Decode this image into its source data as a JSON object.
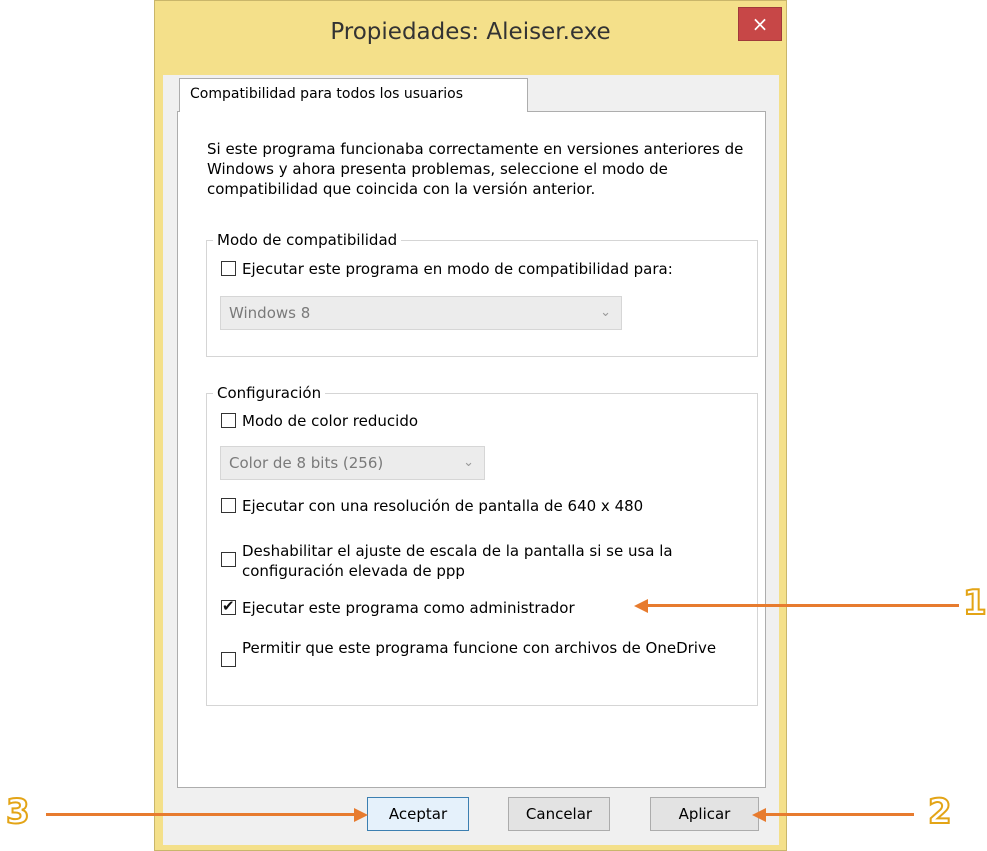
{
  "window": {
    "title": "Propiedades: Aleiser.exe",
    "close_label": "×"
  },
  "tab": {
    "label": "Compatibilidad para todos los usuarios"
  },
  "description": "Si este programa funcionaba correctamente en versiones anteriores de Windows y ahora presenta problemas, seleccione el modo de compatibilidad que coincida con la versión anterior.",
  "compat_group": {
    "legend": "Modo de compatibilidad",
    "checkbox_label": "Ejecutar este programa en modo de compatibilidad para:",
    "checked": false,
    "select_value": "Windows 8"
  },
  "settings_group": {
    "legend": "Configuración",
    "reduced_color": {
      "label": "Modo de color reducido",
      "checked": false
    },
    "color_select_value": "Color de 8 bits (256)",
    "resolution": {
      "label": "Ejecutar con una resolución de pantalla de 640 x 480",
      "checked": false
    },
    "dpi": {
      "label": "Deshabilitar el ajuste de escala de la pantalla si se usa la configuración elevada de ppp",
      "checked": false
    },
    "admin": {
      "label": "Ejecutar este programa como administrador",
      "checked": true
    },
    "onedrive": {
      "label": "Permitir que este programa funcione con archivos de OneDrive",
      "checked": false
    }
  },
  "buttons": {
    "ok": "Aceptar",
    "cancel": "Cancelar",
    "apply": "Aplicar"
  },
  "annotations": {
    "one": "1",
    "two": "2",
    "three": "3"
  },
  "icons": {
    "checkmark": "✔",
    "chevron": "⌄"
  },
  "colors": {
    "accent_arrow": "#e77b2e",
    "title_bar": "#f4e08a",
    "close": "#c74747"
  }
}
